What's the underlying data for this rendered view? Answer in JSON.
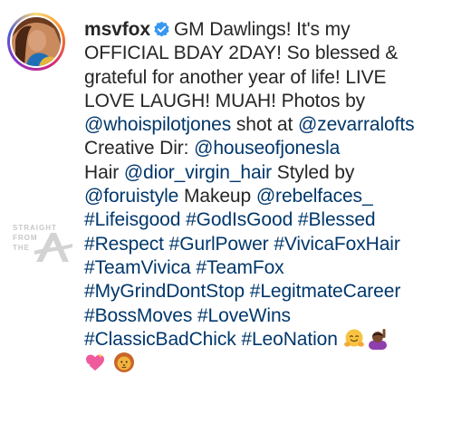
{
  "post": {
    "username": "msvfox",
    "lines": [
      [
        {
          "t": "GM Dawlings! It's my"
        }
      ],
      [
        {
          "t": "OFFICIAL BDAY 2DAY! So blessed &"
        }
      ],
      [
        {
          "t": "grateful for another year of life! LIVE"
        }
      ],
      [
        {
          "t": "LOVE LAUGH! MUAH! Photos by"
        }
      ],
      [
        {
          "t": "@whoispilotjones",
          "link": true,
          "name": "mention-whoispilotjones"
        },
        {
          "t": " shot at "
        },
        {
          "t": "@zevarralofts",
          "link": true,
          "name": "mention-zevarralofts"
        }
      ],
      [
        {
          "t": "Creative Dir: "
        },
        {
          "t": "@houseofjonesla",
          "link": true,
          "name": "mention-houseofjonesla"
        }
      ],
      [
        {
          "t": "Hair "
        },
        {
          "t": "@dior_virgin_hair",
          "link": true,
          "name": "mention-dior-virgin-hair"
        },
        {
          "t": " Styled by"
        }
      ],
      [
        {
          "t": "@foruistyle",
          "link": true,
          "name": "mention-foruistyle"
        },
        {
          "t": " Makeup "
        },
        {
          "t": "@rebelfaces_",
          "link": true,
          "name": "mention-rebelfaces"
        }
      ],
      [
        {
          "t": "#Lifeisgood",
          "link": true,
          "name": "hashtag-lifeisgood"
        },
        {
          "t": " "
        },
        {
          "t": "#GodIsGood",
          "link": true,
          "name": "hashtag-godisgood"
        },
        {
          "t": " "
        },
        {
          "t": "#Blessed",
          "link": true,
          "name": "hashtag-blessed"
        }
      ],
      [
        {
          "t": "#Respect",
          "link": true,
          "name": "hashtag-respect"
        },
        {
          "t": " "
        },
        {
          "t": "#GurlPower",
          "link": true,
          "name": "hashtag-gurlpower"
        },
        {
          "t": " "
        },
        {
          "t": "#VivicaFoxHair",
          "link": true,
          "name": "hashtag-vivicafoxhair"
        }
      ],
      [
        {
          "t": "#TeamVivica",
          "link": true,
          "name": "hashtag-teamvivica"
        },
        {
          "t": " "
        },
        {
          "t": "#TeamFox",
          "link": true,
          "name": "hashtag-teamfox"
        }
      ],
      [
        {
          "t": "#MyGrindDontStop",
          "link": true,
          "name": "hashtag-mygrinddontstop"
        },
        {
          "t": " "
        },
        {
          "t": "#LegitmateCareer",
          "link": true,
          "name": "hashtag-legitmatecareer"
        }
      ],
      [
        {
          "t": "#BossMoves",
          "link": true,
          "name": "hashtag-bossmoves"
        },
        {
          "t": " "
        },
        {
          "t": "#LoveWins",
          "link": true,
          "name": "hashtag-lovewins"
        }
      ],
      [
        {
          "t": "#ClassicBadChick",
          "link": true,
          "name": "hashtag-classicbadchick"
        },
        {
          "t": " "
        },
        {
          "t": "#LeoNation",
          "link": true,
          "name": "hashtag-leonation"
        },
        {
          "t": " "
        },
        {
          "emoji": "hugging-face"
        },
        {
          "emoji": "person-raising-hand"
        }
      ],
      [
        {
          "emoji": "sparkling-heart"
        },
        {
          "t": " "
        },
        {
          "emoji": "lion-face"
        }
      ]
    ]
  },
  "watermark": {
    "line1": "STRAIGHT",
    "line2": "FROM",
    "line3": "THE"
  },
  "icons": {
    "verified": "verified-badge-icon",
    "avatar": "profile-avatar"
  },
  "colors": {
    "text": "#262626",
    "link": "#00376b",
    "verified": "#3897f0"
  }
}
